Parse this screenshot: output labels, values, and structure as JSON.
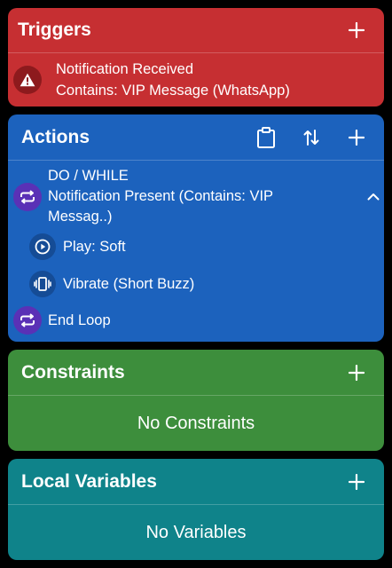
{
  "triggers": {
    "title": "Triggers",
    "items": [
      {
        "icon": "warning-icon",
        "line1": "Notification Received",
        "line2": "Contains: VIP Message (WhatsApp)"
      }
    ],
    "color": "#c62f32"
  },
  "actions": {
    "title": "Actions",
    "loop": {
      "icon": "loop-icon",
      "line1": "DO / WHILE",
      "line2": "Notification Present (Contains: VIP",
      "line3": "Messag..)"
    },
    "children": [
      {
        "icon": "play-icon",
        "label": "Play: Soft"
      },
      {
        "icon": "vibrate-icon",
        "label": "Vibrate (Short Buzz)"
      }
    ],
    "end": {
      "icon": "loop-icon",
      "label": "End Loop"
    },
    "color": "#1c62bd"
  },
  "constraints": {
    "title": "Constraints",
    "empty": "No Constraints",
    "color": "#3d8e3c"
  },
  "variables": {
    "title": "Local Variables",
    "empty": "No Variables",
    "color": "#0f838a"
  }
}
